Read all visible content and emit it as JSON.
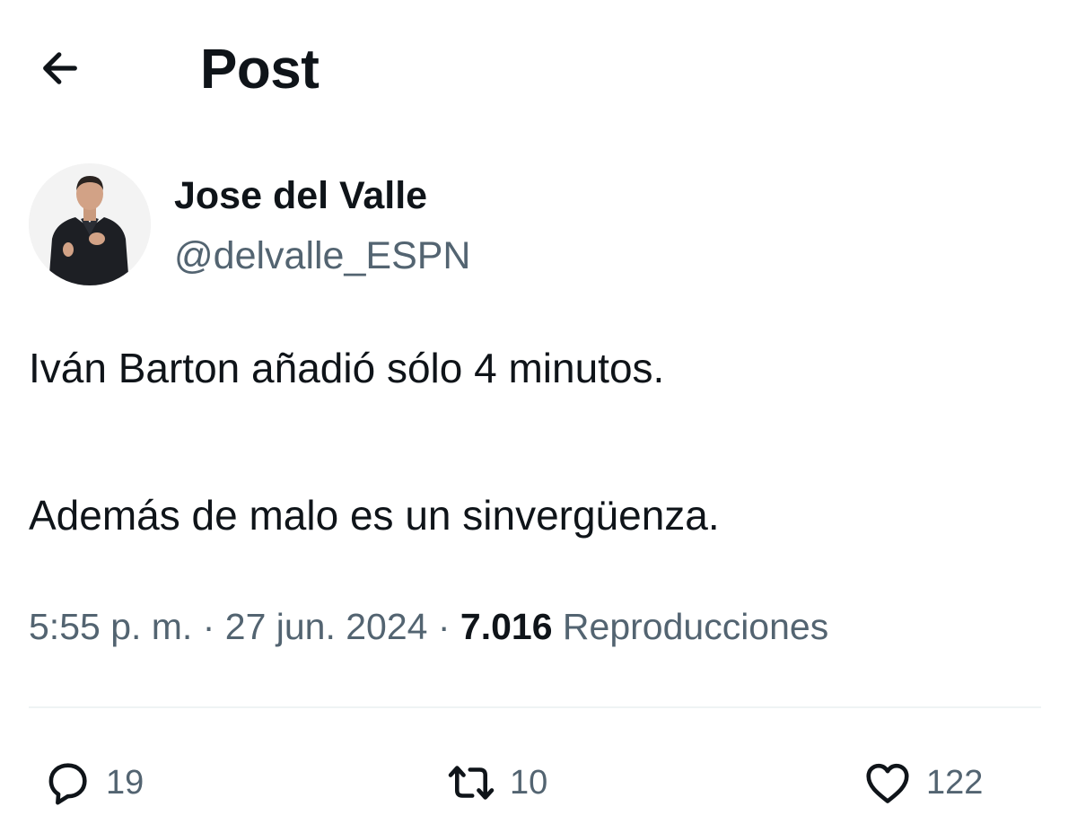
{
  "header": {
    "back_icon": "arrow-left-icon",
    "title": "Post"
  },
  "author": {
    "name": "Jose del Valle",
    "handle": "@delvalle_ESPN"
  },
  "tweet": {
    "lines": [
      "Iván Barton añadió sólo 4 minutos.",
      "Además de malo es un sinvergüenza."
    ]
  },
  "meta": {
    "time": "5:55 p. m.",
    "separator": " · ",
    "date": "27 jun. 2024",
    "views_count": "7.016",
    "views_label": "Reproducciones"
  },
  "actions": {
    "reply": {
      "icon": "reply-icon",
      "count": "19"
    },
    "retweet": {
      "icon": "retweet-icon",
      "count": "10"
    },
    "like": {
      "icon": "heart-icon",
      "count": "122"
    }
  },
  "colors": {
    "text_primary": "#0f1419",
    "text_secondary": "#536471",
    "divider": "#eff3f4",
    "background": "#ffffff"
  }
}
